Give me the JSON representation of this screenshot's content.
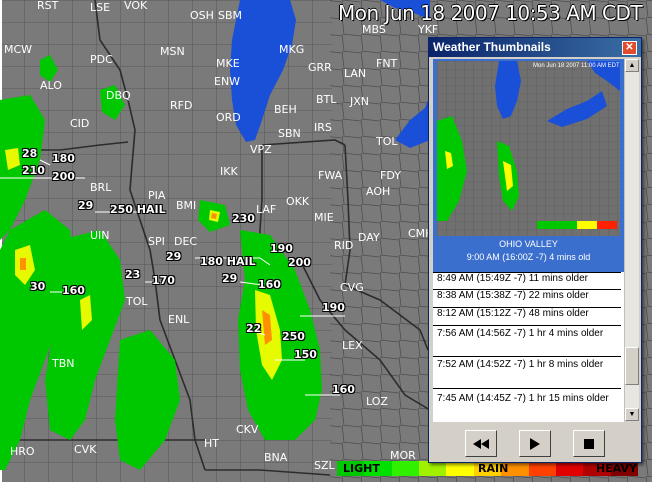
{
  "map": {
    "timestamp": "Mon Jun 18 2007   10:53 AM CDT",
    "cities": [
      {
        "t": "RST"
      },
      {
        "t": "LSE"
      },
      {
        "t": "VOK"
      },
      {
        "t": "OSH"
      },
      {
        "t": "SBM"
      },
      {
        "t": "MBS"
      },
      {
        "t": "YKF"
      },
      {
        "t": "MCW"
      },
      {
        "t": "PDC"
      },
      {
        "t": "MSN"
      },
      {
        "t": "MKE"
      },
      {
        "t": "MKG"
      },
      {
        "t": "GRR"
      },
      {
        "t": "LAN"
      },
      {
        "t": "FNT"
      },
      {
        "t": "ALO"
      },
      {
        "t": "DBQ"
      },
      {
        "t": "ENW"
      },
      {
        "t": "BTL"
      },
      {
        "t": "JXN"
      },
      {
        "t": "RFD"
      },
      {
        "t": "BEH"
      },
      {
        "t": "ORD"
      },
      {
        "t": "SBN"
      },
      {
        "t": "IRS"
      },
      {
        "t": "TOL"
      },
      {
        "t": "CID"
      },
      {
        "t": "VPZ"
      },
      {
        "t": "IKK"
      },
      {
        "t": "FWA"
      },
      {
        "t": "FDY"
      },
      {
        "t": "AOH"
      },
      {
        "t": "BRL"
      },
      {
        "t": "PIA"
      },
      {
        "t": "BMI"
      },
      {
        "t": "LAF"
      },
      {
        "t": "OKK"
      },
      {
        "t": "MIE"
      },
      {
        "t": "CMH"
      },
      {
        "t": "UIN"
      },
      {
        "t": "SPI"
      },
      {
        "t": "DEC"
      },
      {
        "t": "RID"
      },
      {
        "t": "DAY"
      },
      {
        "t": "CVG"
      },
      {
        "t": "TOL"
      },
      {
        "t": "ENL"
      },
      {
        "t": "TBN"
      },
      {
        "t": "LEX"
      },
      {
        "t": "LOZ"
      },
      {
        "t": "HRO"
      },
      {
        "t": "CVK"
      },
      {
        "t": "HT"
      },
      {
        "t": "CKV"
      },
      {
        "t": "BNA"
      },
      {
        "t": "SZL"
      },
      {
        "t": "MOR"
      }
    ],
    "storms": [
      {
        "t": "28"
      },
      {
        "t": "180"
      },
      {
        "t": "210"
      },
      {
        "t": "200"
      },
      {
        "t": "29"
      },
      {
        "t": "250 HAIL"
      },
      {
        "t": "230"
      },
      {
        "t": "29"
      },
      {
        "t": "180 HAIL"
      },
      {
        "t": "190"
      },
      {
        "t": "200"
      },
      {
        "t": "23"
      },
      {
        "t": "170"
      },
      {
        "t": "29"
      },
      {
        "t": "160"
      },
      {
        "t": "30"
      },
      {
        "t": "160"
      },
      {
        "t": "190"
      },
      {
        "t": "22"
      },
      {
        "t": "250"
      },
      {
        "t": "150"
      },
      {
        "t": "160"
      }
    ],
    "legend": {
      "light": "LIGHT",
      "rain": "RAIN",
      "heavy": "HEAVY",
      "colors": [
        "#00c800",
        "#00e000",
        "#30f000",
        "#a0f000",
        "#ffff00",
        "#ffd000",
        "#ff9000",
        "#ff4000",
        "#e00000",
        "#b00000",
        "#800000"
      ]
    },
    "colors": {
      "land": "#7a7a7a",
      "lake": "#1a4fd8",
      "border": "#444444"
    }
  },
  "window": {
    "title": "Weather Thumbnails",
    "panel": {
      "title": "OHIO VALLEY",
      "subtitle": "9:00 AM (16:00Z -7) 4 mins old",
      "thumb_stamp": "Mon Jun 18 2007 11:00 AM EDT"
    },
    "list": [
      {
        "label": "8:49 AM (15:49Z -7) 11 mins older"
      },
      {
        "label": "8:38 AM (15:38Z -7) 22 mins older"
      },
      {
        "label": "8:12 AM (15:12Z -7) 48 mins older"
      },
      {
        "label": "7:56 AM (14:56Z -7) 1 hr 4 mins older"
      },
      {
        "label": "7:52 AM (14:52Z -7) 1 hr 8 mins older"
      },
      {
        "label": "7:45 AM (14:45Z -7) 1 hr 15 mins older"
      }
    ],
    "controls": {
      "rewind": "rewind-icon",
      "play": "play-icon",
      "stop": "stop-icon"
    }
  }
}
